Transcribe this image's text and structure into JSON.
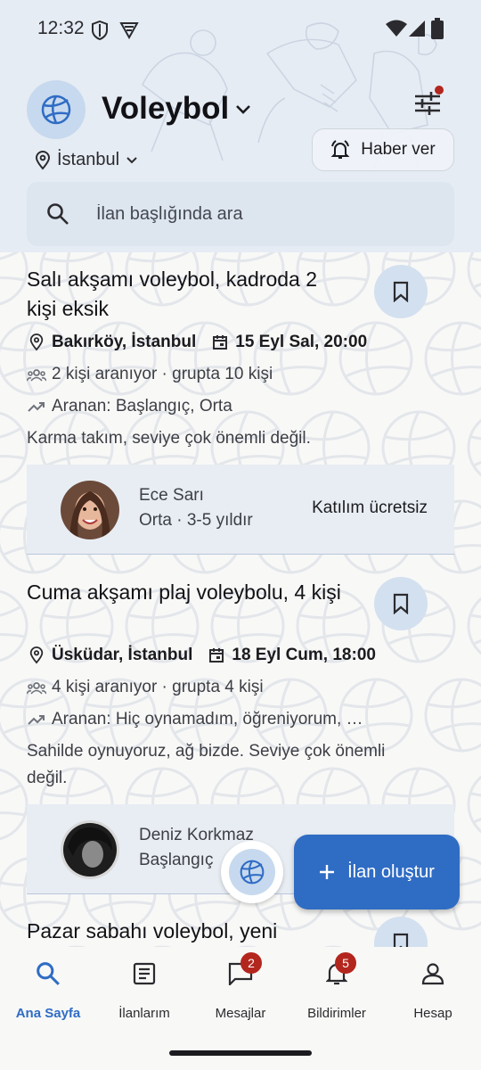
{
  "status_bar": {
    "time": "12:32"
  },
  "header": {
    "sport_title": "Voleybol",
    "location": "İstanbul",
    "notify_label": "Haber ver",
    "search_placeholder": "İlan başlığında ara"
  },
  "listings": [
    {
      "title": "Salı akşamı voleybol, kadroda 2 kişi eksik",
      "place": "Bakırköy, İstanbul",
      "datetime": "15 Eyl Sal, 20:00",
      "people": "2 kişi aranıyor · grupta 10 kişi",
      "level_wanted": "Aranan: Başlangıç, Orta",
      "description": "Karma takım, seviye çok önemli değil.",
      "owner_name": "Ece Sarı",
      "owner_level": "Orta · 3-5 yıldır",
      "fee": "Katılım ücretsiz"
    },
    {
      "title": "Cuma akşamı plaj voleybolu, 4 kişi",
      "place": "Üsküdar, İstanbul",
      "datetime": "18 Eyl Cum, 18:00",
      "people": "4 kişi aranıyor · grupta 4 kişi",
      "level_wanted": "Aranan: Hiç oynamadım, öğreniyorum, …",
      "description": "Sahilde oynuyoruz, ağ bizde. Seviye çok önemli değil.",
      "owner_name": "Deniz Korkmaz",
      "owner_level": "Başlangıç"
    },
    {
      "title": "Pazar sabahı voleybol, yeni"
    }
  ],
  "fab": {
    "label": "İlan oluştur"
  },
  "bottom_nav": [
    {
      "label": "Ana Sayfa",
      "icon": "search-icon",
      "active": true
    },
    {
      "label": "İlanlarım",
      "icon": "article-icon"
    },
    {
      "label": "Mesajlar",
      "icon": "chat-icon",
      "badge": "2"
    },
    {
      "label": "Bildirimler",
      "icon": "bell-icon",
      "badge": "5"
    },
    {
      "label": "Hesap",
      "icon": "person-icon"
    }
  ],
  "colors": {
    "accent": "#2f6cc4",
    "header_bg": "#e6ecf4",
    "badge": "#b3261e",
    "chip_bg": "#d3e0ef"
  }
}
